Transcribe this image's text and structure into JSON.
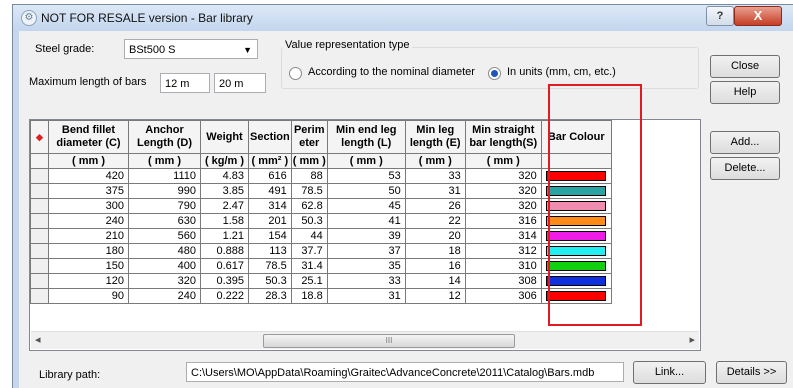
{
  "window": {
    "title": "NOT FOR RESALE version - Bar library",
    "help_glyph": "?",
    "close_glyph": "X"
  },
  "steel_grade": {
    "label": "Steel grade:",
    "value": "BSt500 S"
  },
  "max_length": {
    "label": "Maximum length of bars",
    "value1": "12 m",
    "value2": "20 m"
  },
  "value_rep": {
    "label": "Value representation type",
    "option_nominal": "According to the nominal diameter",
    "option_units": "In units (mm, cm, etc.)",
    "selected": "units"
  },
  "buttons": {
    "close": "Close",
    "help": "Help",
    "add": "Add...",
    "delete": "Delete...",
    "link": "Link...",
    "details": "Details >>"
  },
  "table": {
    "corner_glyph": "◆",
    "headers": [
      "Bend fillet diameter (C)",
      "Anchor Length (D)",
      "Weight",
      "Section",
      "Perim eter",
      "Min end leg length (L)",
      "Min leg length (E)",
      "Min straight bar length(S)",
      "Bar Colour"
    ],
    "units": [
      "( mm )",
      "( mm )",
      "( kg/m )",
      "( mm² )",
      "( mm )",
      "( mm )",
      "( mm )",
      "( mm )",
      ""
    ],
    "rows": [
      {
        "cells": [
          "420",
          "1110",
          "4.83",
          "616",
          "88",
          "53",
          "33",
          "320"
        ],
        "colour": "#ff0000"
      },
      {
        "cells": [
          "375",
          "990",
          "3.85",
          "491",
          "78.5",
          "50",
          "31",
          "320"
        ],
        "colour": "#2aa3a3"
      },
      {
        "cells": [
          "300",
          "790",
          "2.47",
          "314",
          "62.8",
          "45",
          "26",
          "320"
        ],
        "colour": "#f08cb0"
      },
      {
        "cells": [
          "240",
          "630",
          "1.58",
          "201",
          "50.3",
          "41",
          "22",
          "316"
        ],
        "colour": "#ff8a1a"
      },
      {
        "cells": [
          "210",
          "560",
          "1.21",
          "154",
          "44",
          "39",
          "20",
          "314"
        ],
        "colour": "#ee1ce6"
      },
      {
        "cells": [
          "180",
          "480",
          "0.888",
          "113",
          "37.7",
          "37",
          "18",
          "312"
        ],
        "colour": "#22eef0"
      },
      {
        "cells": [
          "150",
          "400",
          "0.617",
          "78.5",
          "31.4",
          "35",
          "16",
          "310"
        ],
        "colour": "#10d010"
      },
      {
        "cells": [
          "120",
          "320",
          "0.395",
          "50.3",
          "25.1",
          "33",
          "14",
          "308"
        ],
        "colour": "#1030e0"
      },
      {
        "cells": [
          "90",
          "240",
          "0.222",
          "28.3",
          "18.8",
          "31",
          "12",
          "306"
        ],
        "colour": "#ff0000"
      }
    ]
  },
  "library_path": {
    "label": "Library path:",
    "value": "C:\\Users\\MO\\AppData\\Roaming\\Graitec\\AdvanceConcrete\\2011\\Catalog\\Bars.mdb"
  },
  "scrollbar": {
    "left_arrow": "◂",
    "right_arrow": "▸",
    "grip": "III"
  },
  "highlight_color": "#e01b24"
}
